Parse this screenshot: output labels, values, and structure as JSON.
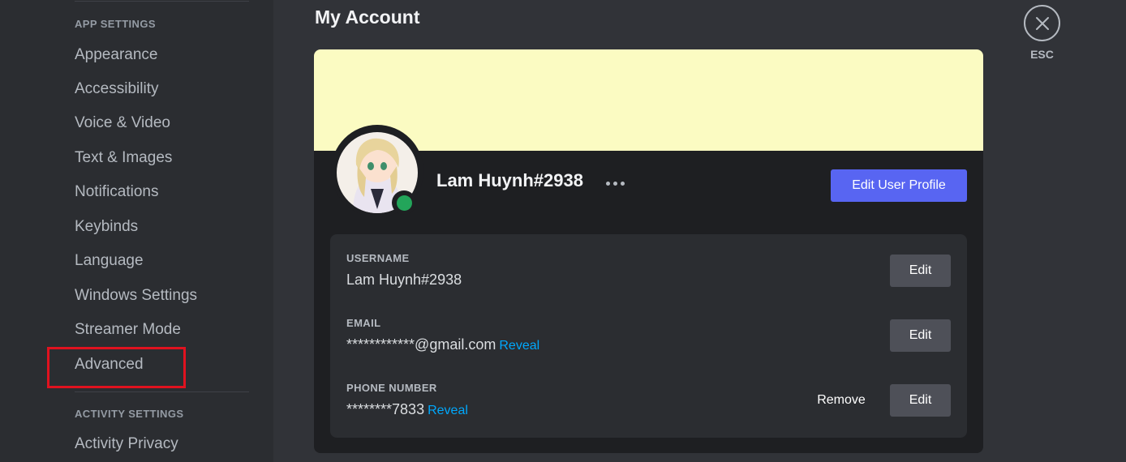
{
  "sidebar": {
    "app_settings_header": "APP SETTINGS",
    "activity_settings_header": "ACTIVITY SETTINGS",
    "items": [
      {
        "label": "Appearance"
      },
      {
        "label": "Accessibility"
      },
      {
        "label": "Voice & Video"
      },
      {
        "label": "Text & Images"
      },
      {
        "label": "Notifications"
      },
      {
        "label": "Keybinds"
      },
      {
        "label": "Language"
      },
      {
        "label": "Windows Settings"
      },
      {
        "label": "Streamer Mode"
      },
      {
        "label": "Advanced"
      }
    ],
    "activity_items": [
      {
        "label": "Activity Privacy"
      }
    ]
  },
  "main": {
    "title": "My Account",
    "close_label": "ESC"
  },
  "profile": {
    "display_name": "Lam Huynh#2938",
    "edit_profile_label": "Edit User Profile",
    "banner_color": "#fbfbc2",
    "status_color": "#23a55a"
  },
  "fields": {
    "username_label": "USERNAME",
    "username_value": "Lam Huynh#2938",
    "email_label": "EMAIL",
    "email_value": "************@gmail.com",
    "phone_label": "PHONE NUMBER",
    "phone_value": "********7833",
    "reveal_label": "Reveal",
    "edit_label": "Edit",
    "remove_label": "Remove"
  },
  "colors": {
    "accent": "#5865f2",
    "link": "#00a8fc",
    "highlight": "#e0121f"
  }
}
